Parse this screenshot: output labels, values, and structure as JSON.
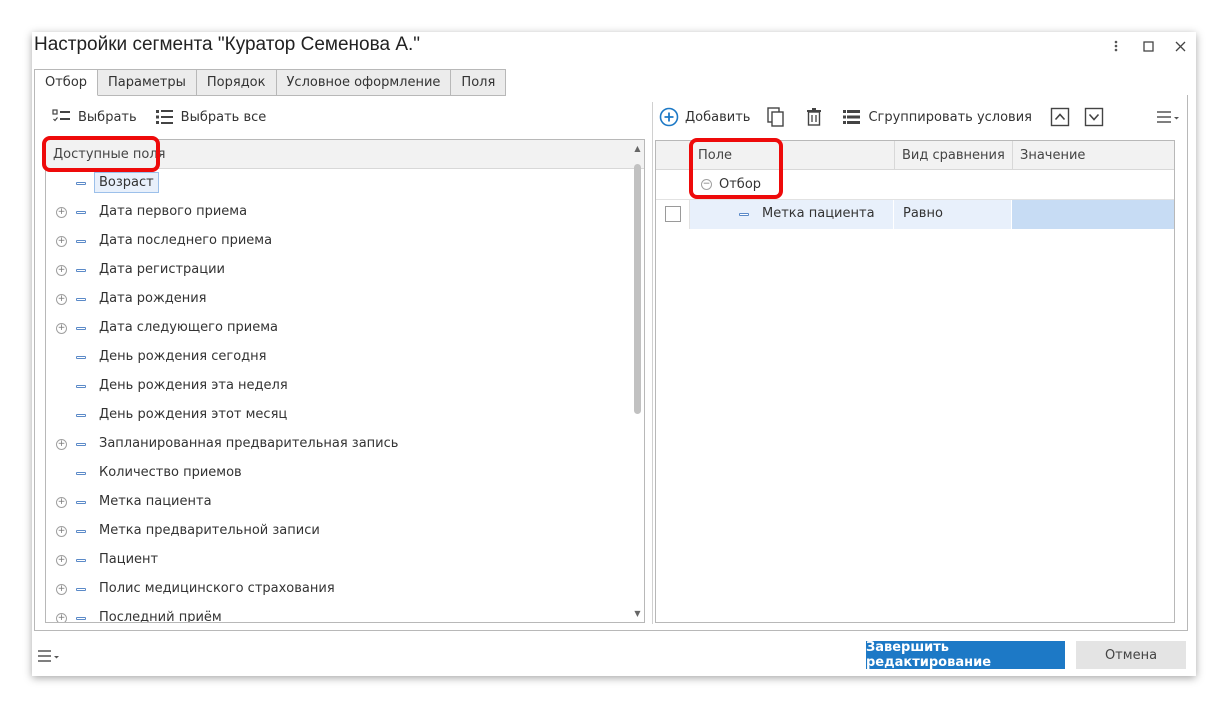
{
  "window": {
    "title": "Настройки сегмента \"Куратор Семенова А.\"",
    "more_icon": "kebab-vertical-icon",
    "maximize_icon": "maximize-icon",
    "close_icon": "close-icon"
  },
  "tabs": [
    {
      "label": "Отбор",
      "active": true
    },
    {
      "label": "Параметры",
      "active": false
    },
    {
      "label": "Порядок",
      "active": false
    },
    {
      "label": "Условное оформление",
      "active": false
    },
    {
      "label": "Поля",
      "active": false
    }
  ],
  "left_toolbar": {
    "select_label": "Выбрать",
    "select_all_label": "Выбрать все"
  },
  "available_fields": {
    "header": "Доступные поля",
    "items": [
      {
        "label": "Возраст",
        "expandable": false,
        "selected": true
      },
      {
        "label": "Дата первого приема",
        "expandable": true
      },
      {
        "label": "Дата последнего приема",
        "expandable": true
      },
      {
        "label": "Дата регистрации",
        "expandable": true
      },
      {
        "label": "Дата рождения",
        "expandable": true
      },
      {
        "label": "Дата следующего приема",
        "expandable": true
      },
      {
        "label": "День рождения сегодня",
        "expandable": false
      },
      {
        "label": "День рождения эта неделя",
        "expandable": false
      },
      {
        "label": "День рождения этот месяц",
        "expandable": false
      },
      {
        "label": "Запланированная предварительная запись",
        "expandable": true
      },
      {
        "label": "Количество приемов",
        "expandable": false
      },
      {
        "label": "Метка пациента",
        "expandable": true
      },
      {
        "label": "Метка предварительной записи",
        "expandable": true
      },
      {
        "label": "Пациент",
        "expandable": true
      },
      {
        "label": "Полис медицинского страхования",
        "expandable": true
      },
      {
        "label": "Последний приём",
        "expandable": true
      }
    ]
  },
  "right_toolbar": {
    "add_label": "Добавить",
    "group_label": "Сгруппировать условия"
  },
  "filter_grid": {
    "col_field": "Поле",
    "col_compare": "Вид сравнения",
    "col_value": "Значение",
    "group_label": "Отбор",
    "row_field": "Метка пациента",
    "row_compare": "Равно",
    "row_value": ""
  },
  "footer": {
    "finish_label": "Завершить редактирование",
    "cancel_label": "Отмена"
  },
  "colors": {
    "accent": "#1d79c6",
    "highlight": "#ee0a0a",
    "selected_row": "#e8f0fb"
  }
}
